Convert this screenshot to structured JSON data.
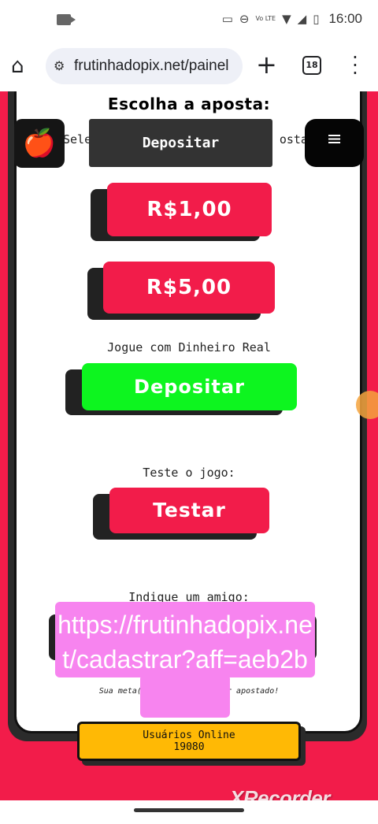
{
  "status": {
    "time": "16:00",
    "network": "Vo LTE"
  },
  "browser": {
    "url": "frutinhadopix.net/painel",
    "tab_count": "18"
  },
  "page": {
    "heading": "Escolha a aposta:",
    "subtext_left": "Sele",
    "subtext_right": "ostar",
    "top_deposit_label": "Depositar",
    "bet_buttons": [
      "R$1,00",
      "R$5,00"
    ],
    "real_money_label": "Jogue com Dinheiro Real",
    "deposit_button": "Depositar",
    "test_label": "Teste o jogo:",
    "test_button": "Testar",
    "referral_label": "Indique um amigo:",
    "meta_left": "Sua meta(g",
    "meta_right": "or apostado!",
    "online_label": "Usuários Online",
    "online_count": "19080"
  },
  "overlay": {
    "referral_link": "https://frutinhadopix.net/cadastrar?aff=aeb2b"
  },
  "watermark": "XRecorder",
  "colors": {
    "page_bg": "#f21c4a",
    "bet_button": "#f21c4a",
    "deposit_button": "#0df51f",
    "online_badge": "#ffb905",
    "overlay": "#f784ef"
  }
}
